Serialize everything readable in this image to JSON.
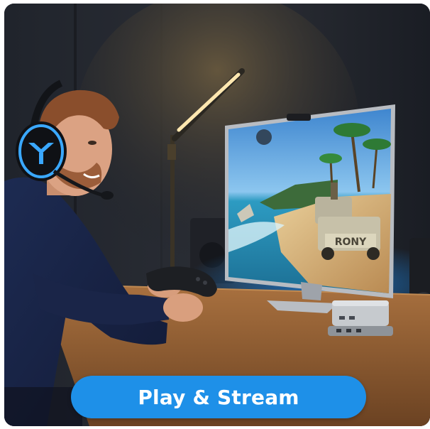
{
  "banner": {
    "label": "Play & Stream"
  },
  "monitor": {
    "truck_plate": "RONY"
  },
  "icons": {
    "headset_logo": "y-logo-icon"
  },
  "colors": {
    "banner_bg": "#1e90e8",
    "banner_text": "#ffffff",
    "headset_glow": "#3aa8ff",
    "lamp_light": "#ffe7b0",
    "backlight_blue": "#1d7fd6"
  }
}
